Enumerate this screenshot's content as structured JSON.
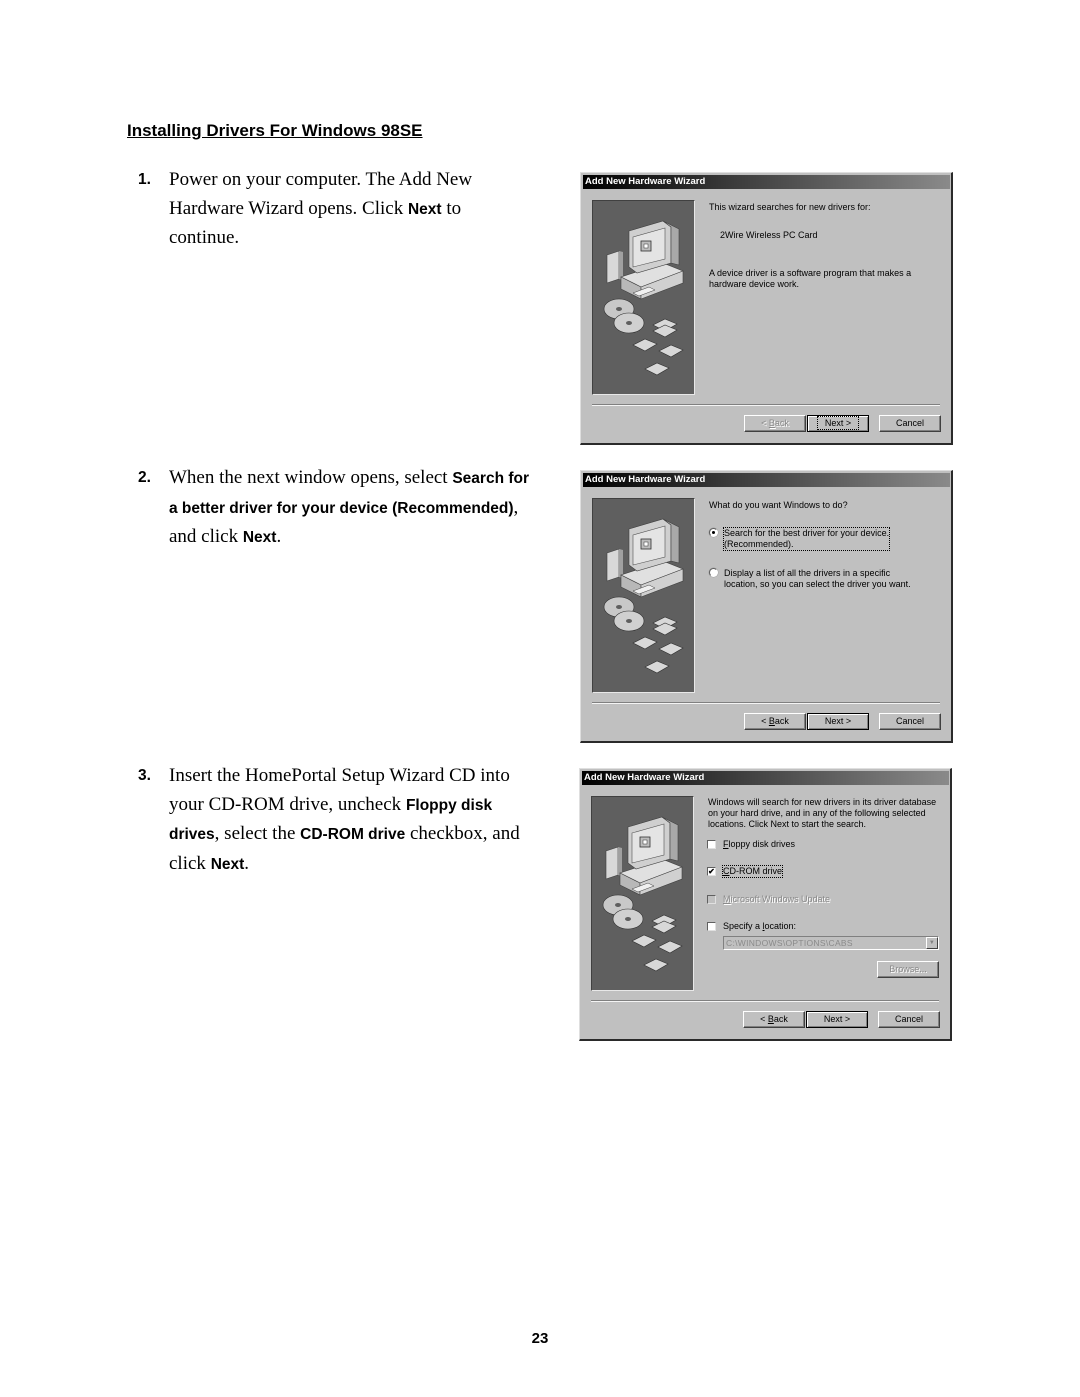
{
  "heading": "Installing Drivers For Windows 98SE",
  "steps": [
    {
      "number": "1.",
      "parts": [
        {
          "t": "Power on your computer. The Add New Hardware Wizard opens. Click "
        },
        {
          "b": "Next"
        },
        {
          "t": " to continue."
        }
      ]
    },
    {
      "number": "2.",
      "parts": [
        {
          "t": "When the next window opens, select "
        },
        {
          "b": "Search for a better driver for your device (Recommended)"
        },
        {
          "t": ", and click "
        },
        {
          "b": "Next"
        },
        {
          "t": "."
        }
      ]
    },
    {
      "number": "3.",
      "parts": [
        {
          "t": "Insert the HomePortal Setup Wizard CD into your CD-ROM drive, uncheck "
        },
        {
          "b": "Floppy disk drives"
        },
        {
          "t": ", select the "
        },
        {
          "b": "CD-ROM drive"
        },
        {
          "t": " checkbox, and click "
        },
        {
          "b": "Next"
        },
        {
          "t": "."
        }
      ]
    }
  ],
  "dialogs": {
    "d1": {
      "title": "Add New Hardware Wizard",
      "intro": "This wizard searches for new drivers for:",
      "device": "2Wire Wireless PC Card",
      "description": "A device driver is a software program that makes a hardware device work.",
      "back_pre": "< ",
      "back_u": "B",
      "back_post": "ack",
      "next": "Next >",
      "cancel": "Cancel"
    },
    "d2": {
      "title": "Add New Hardware Wizard",
      "question": "What do you want Windows to do?",
      "option1_line1": "Search for the best driver for your device.",
      "option1_line2": "(Recommended).",
      "option1_selected": true,
      "option2_line1": "Display a list of all the drivers in a specific",
      "option2_line2": "location, so you can select the driver you want.",
      "option2_selected": false,
      "back_pre": "< ",
      "back_u": "B",
      "back_post": "ack",
      "next": "Next >",
      "cancel": "Cancel"
    },
    "d3": {
      "title": "Add New Hardware Wizard",
      "info_line1": "Windows will search for new drivers in its driver database",
      "info_line2": "on your hard drive, and in any of the following selected",
      "info_line3": "locations. Click Next to start the search.",
      "floppy_u": "F",
      "floppy_rest": "loppy disk drives",
      "floppy_checked": false,
      "cdrom_u": "C",
      "cdrom_rest": "D-ROM drive",
      "cdrom_checked": true,
      "update_u": "M",
      "update_rest": "icrosoft Windows Update",
      "update_checked": false,
      "location_pre": "Specify a ",
      "location_u": "l",
      "location_post": "ocation:",
      "location_checked": false,
      "location_value": "C:\\WINDOWS\\OPTIONS\\CABS",
      "browse": "Browse...",
      "back_pre": "< ",
      "back_u": "B",
      "back_post": "ack",
      "next": "Next >",
      "cancel": "Cancel"
    }
  },
  "icons": {
    "check": "✔",
    "dropdown": "▼"
  },
  "page_number": "23"
}
